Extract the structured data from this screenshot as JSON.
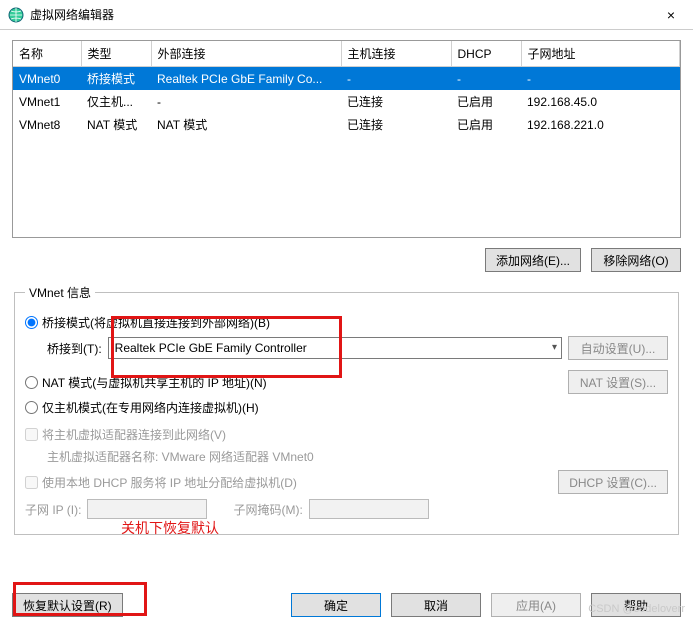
{
  "window": {
    "title": "虚拟网络编辑器",
    "close": "×"
  },
  "table": {
    "headers": [
      "名称",
      "类型",
      "外部连接",
      "主机连接",
      "DHCP",
      "子网地址"
    ],
    "rows": [
      {
        "name": "VMnet0",
        "type": "桥接模式",
        "ext": "Realtek PCIe GbE Family Co...",
        "host": "-",
        "dhcp": "-",
        "subnet": "-",
        "selected": true
      },
      {
        "name": "VMnet1",
        "type": "仅主机...",
        "ext": "-",
        "host": "已连接",
        "dhcp": "已启用",
        "subnet": "192.168.45.0",
        "selected": false
      },
      {
        "name": "VMnet8",
        "type": "NAT 模式",
        "ext": "NAT 模式",
        "host": "已连接",
        "dhcp": "已启用",
        "subnet": "192.168.221.0",
        "selected": false
      }
    ]
  },
  "buttons": {
    "add_network": "添加网络(E)...",
    "remove_network": "移除网络(O)"
  },
  "group": {
    "title": "VMnet 信息",
    "radio_bridge": "桥接模式(将虚拟机直接连接到外部网络)(B)",
    "bridge_to_label": "桥接到(T):",
    "bridge_to_value": "Realtek PCIe GbE Family Controller",
    "auto_setting": "自动设置(U)...",
    "radio_nat": "NAT 模式(与虚拟机共享主机的 IP 地址)(N)",
    "nat_setting": "NAT 设置(S)...",
    "radio_hostonly": "仅主机模式(在专用网络内连接虚拟机)(H)",
    "chk_host_adapter": "将主机虚拟适配器连接到此网络(V)",
    "host_adapter_name": "主机虚拟适配器名称: VMware 网络适配器 VMnet0",
    "chk_dhcp": "使用本地 DHCP 服务将 IP 地址分配给虚拟机(D)",
    "dhcp_setting": "DHCP 设置(C)...",
    "subnet_ip_label": "子网 IP (I):",
    "subnet_mask_label": "子网掩码(M):"
  },
  "bottom": {
    "restore": "恢复默认设置(R)",
    "ok": "确定",
    "cancel": "取消",
    "apply": "应用(A)",
    "help": "帮助"
  },
  "annotations": {
    "red_text": "关机下恢复默认"
  },
  "watermark": "CSDN @codeloverr"
}
